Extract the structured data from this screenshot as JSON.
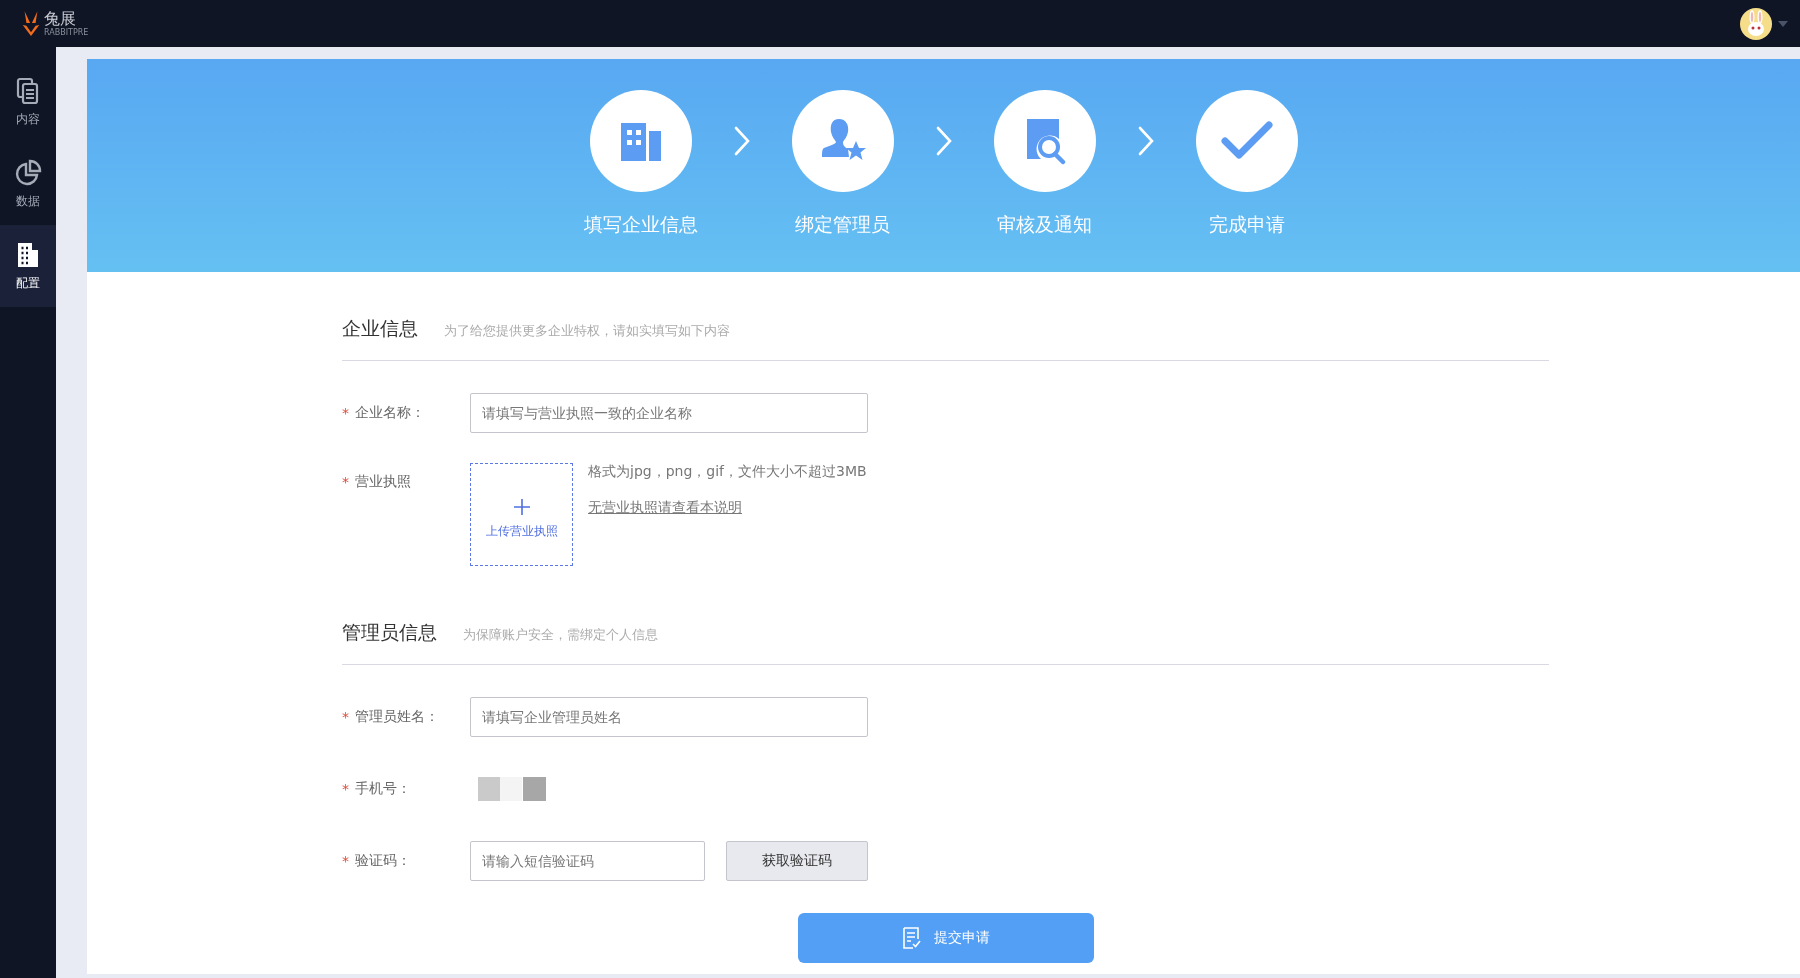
{
  "header": {
    "logo_text": "兔展",
    "logo_subtext": "RABBITPRE"
  },
  "sidebar": {
    "items": [
      {
        "label": "内容",
        "selected": false
      },
      {
        "label": "数据",
        "selected": false
      },
      {
        "label": "配置",
        "selected": true
      }
    ]
  },
  "steps": [
    {
      "label": "填写企业信息"
    },
    {
      "label": "绑定管理员"
    },
    {
      "label": "审核及通知"
    },
    {
      "label": "完成申请"
    }
  ],
  "sections": [
    {
      "title": "企业信息",
      "hint": "为了给您提供更多企业特权，请如实填写如下内容",
      "fields": [
        {
          "kind": "input",
          "label": "企业名称：",
          "required_mark": "*",
          "placeholder": "请填写与营业执照一致的企业名称"
        },
        {
          "kind": "upload",
          "label": "营业执照",
          "required_mark": "*",
          "upload_label": "上传营业执照",
          "note": "格式为jpg，png，gif，文件大小不超过3MB",
          "link": "无营业执照请查看本说明"
        }
      ]
    },
    {
      "title": "管理员信息",
      "hint": "为保障账户安全，需绑定个人信息",
      "fields": [
        {
          "kind": "input",
          "label": "管理员姓名：",
          "required_mark": "*",
          "placeholder": "请填写企业管理员姓名"
        },
        {
          "kind": "masked",
          "label": "手机号：",
          "required_mark": "*"
        },
        {
          "kind": "code",
          "label": "验证码：",
          "required_mark": "*",
          "placeholder": "请输入短信验证码",
          "button": "获取验证码"
        }
      ]
    }
  ],
  "submit": "提交申请"
}
